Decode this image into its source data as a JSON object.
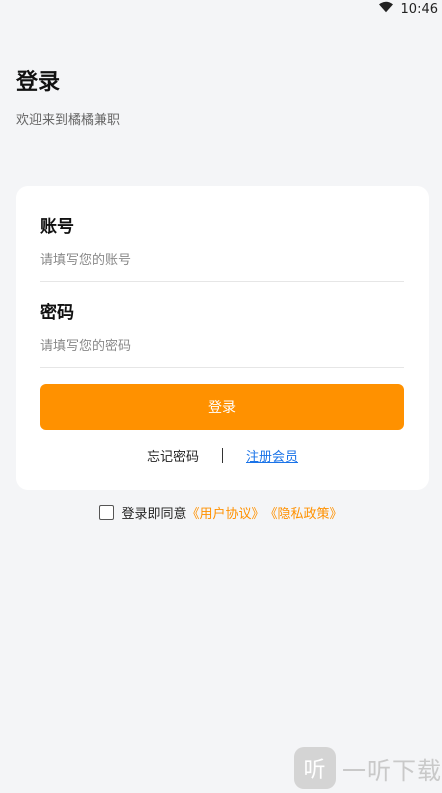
{
  "status_bar": {
    "time": "10:46",
    "wifi_icon": "wifi-icon"
  },
  "header": {
    "title": "登录",
    "welcome": "欢迎来到橘橘兼职"
  },
  "form": {
    "account_label": "账号",
    "account_placeholder": "请填写您的账号",
    "password_label": "密码",
    "password_placeholder": "请填写您的密码",
    "login_button": "登录",
    "forgot_password": "忘记密码",
    "register": "注册会员"
  },
  "agreement": {
    "prefix": "登录即同意",
    "user_agreement": "《用户协议》",
    "privacy_policy": "《隐私政策》",
    "checked": false
  },
  "watermark": {
    "logo_char": "听",
    "text": "一听下载"
  },
  "colors": {
    "accent": "#ff9100",
    "link_blue": "#1a73e8",
    "background": "#f4f5f7"
  }
}
